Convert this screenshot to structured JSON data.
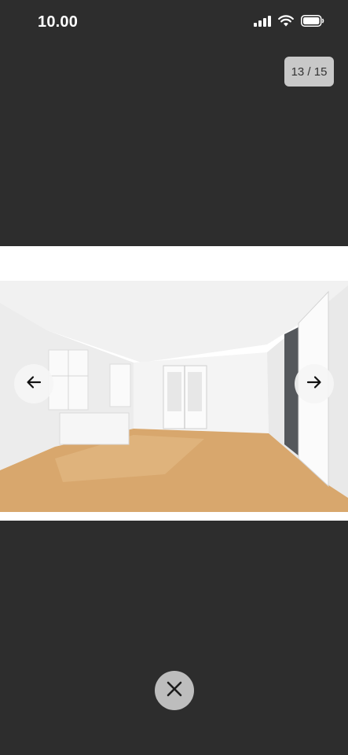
{
  "status_bar": {
    "time": "10.00",
    "icons": [
      "signal-icon",
      "wifi-icon",
      "battery-icon"
    ]
  },
  "gallery": {
    "counter": "13 / 15",
    "current_index": 13,
    "total": 15,
    "prev_icon": "arrow-left-icon",
    "next_icon": "arrow-right-icon",
    "close_icon": "close-icon"
  },
  "colors": {
    "background": "#2d2d2d",
    "counter_bg": "#c8c8c8",
    "close_bg": "#bdbdbd",
    "nav_bg": "#f5f5f5"
  }
}
